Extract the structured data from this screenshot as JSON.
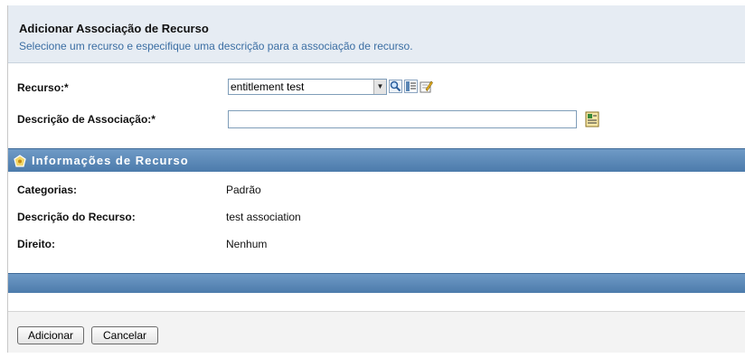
{
  "dialog": {
    "title": "Adicionar Associação de Recurso",
    "subtitle": "Selecione um recurso e especifique uma descrição para a associação de recurso."
  },
  "form": {
    "resource_label": "Recurso:*",
    "resource_value": "entitlement test",
    "association_label": "Descrição de Associação:*",
    "association_value": ""
  },
  "resource_info": {
    "section_title": "Informações de Recurso",
    "rows": [
      {
        "label": "Categorias:",
        "value": "Padrão"
      },
      {
        "label": "Descrição do Recurso:",
        "value": "test association"
      },
      {
        "label": "Direito:",
        "value": "Nenhum"
      }
    ]
  },
  "footer": {
    "add_label": "Adicionar",
    "cancel_label": "Cancelar"
  },
  "colors": {
    "header_bg": "#e6ecf3",
    "subtitle": "#3b6ea3",
    "section_bar": "#5a86b5"
  },
  "icons": [
    "dropdown-arrow-icon",
    "search-icon",
    "browse-icon",
    "edit-icon",
    "language-icon",
    "info-section-icon"
  ]
}
